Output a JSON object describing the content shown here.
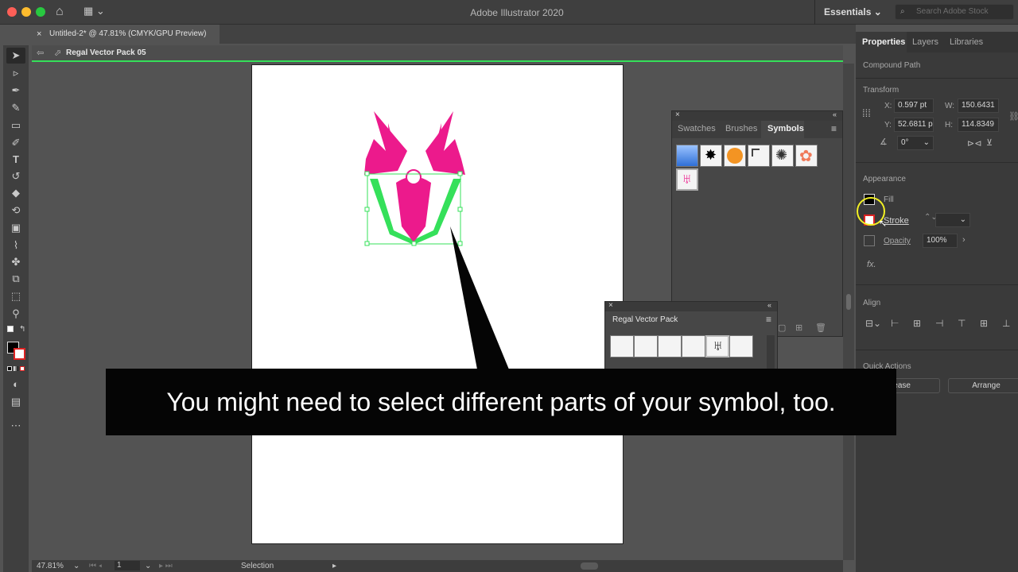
{
  "app": {
    "title": "Adobe Illustrator 2020",
    "workspace": "Essentials",
    "search_placeholder": "Search Adobe Stock"
  },
  "document": {
    "tab_label": "Untitled-2* @ 47.81% (CMYK/GPU Preview)",
    "isolation_label": "Regal Vector Pack 05"
  },
  "properties": {
    "tabs": [
      "Properties",
      "Layers",
      "Libraries"
    ],
    "selection_type": "Compound Path",
    "transform": {
      "section": "Transform",
      "x_label": "X:",
      "x": "0.597 pt",
      "y_label": "Y:",
      "y": "52.6811 p",
      "w_label": "W:",
      "w": "150.6431",
      "h_label": "H:",
      "h": "114.8349",
      "angle": "0°"
    },
    "appearance": {
      "section": "Appearance",
      "fill": "Fill",
      "stroke": "Stroke",
      "opacity_label": "Opacity",
      "opacity": "100%",
      "fx": "fx."
    },
    "align": {
      "section": "Align"
    },
    "quick_actions": {
      "section": "Quick Actions",
      "release": "lease",
      "arrange": "Arrange"
    }
  },
  "symbols_panel": {
    "tabs": [
      "Swatches",
      "Brushes",
      "Symbols"
    ]
  },
  "regal_panel": {
    "title": "Regal Vector Pack"
  },
  "status": {
    "zoom": "47.81%",
    "artboard": "1",
    "tool": "Selection"
  },
  "caption": {
    "text": "You might need to select different parts of your symbol, too."
  },
  "colors": {
    "selection": "#35e05a",
    "accent_pink": "#ec1a8c",
    "highlight": "#f2f024"
  }
}
